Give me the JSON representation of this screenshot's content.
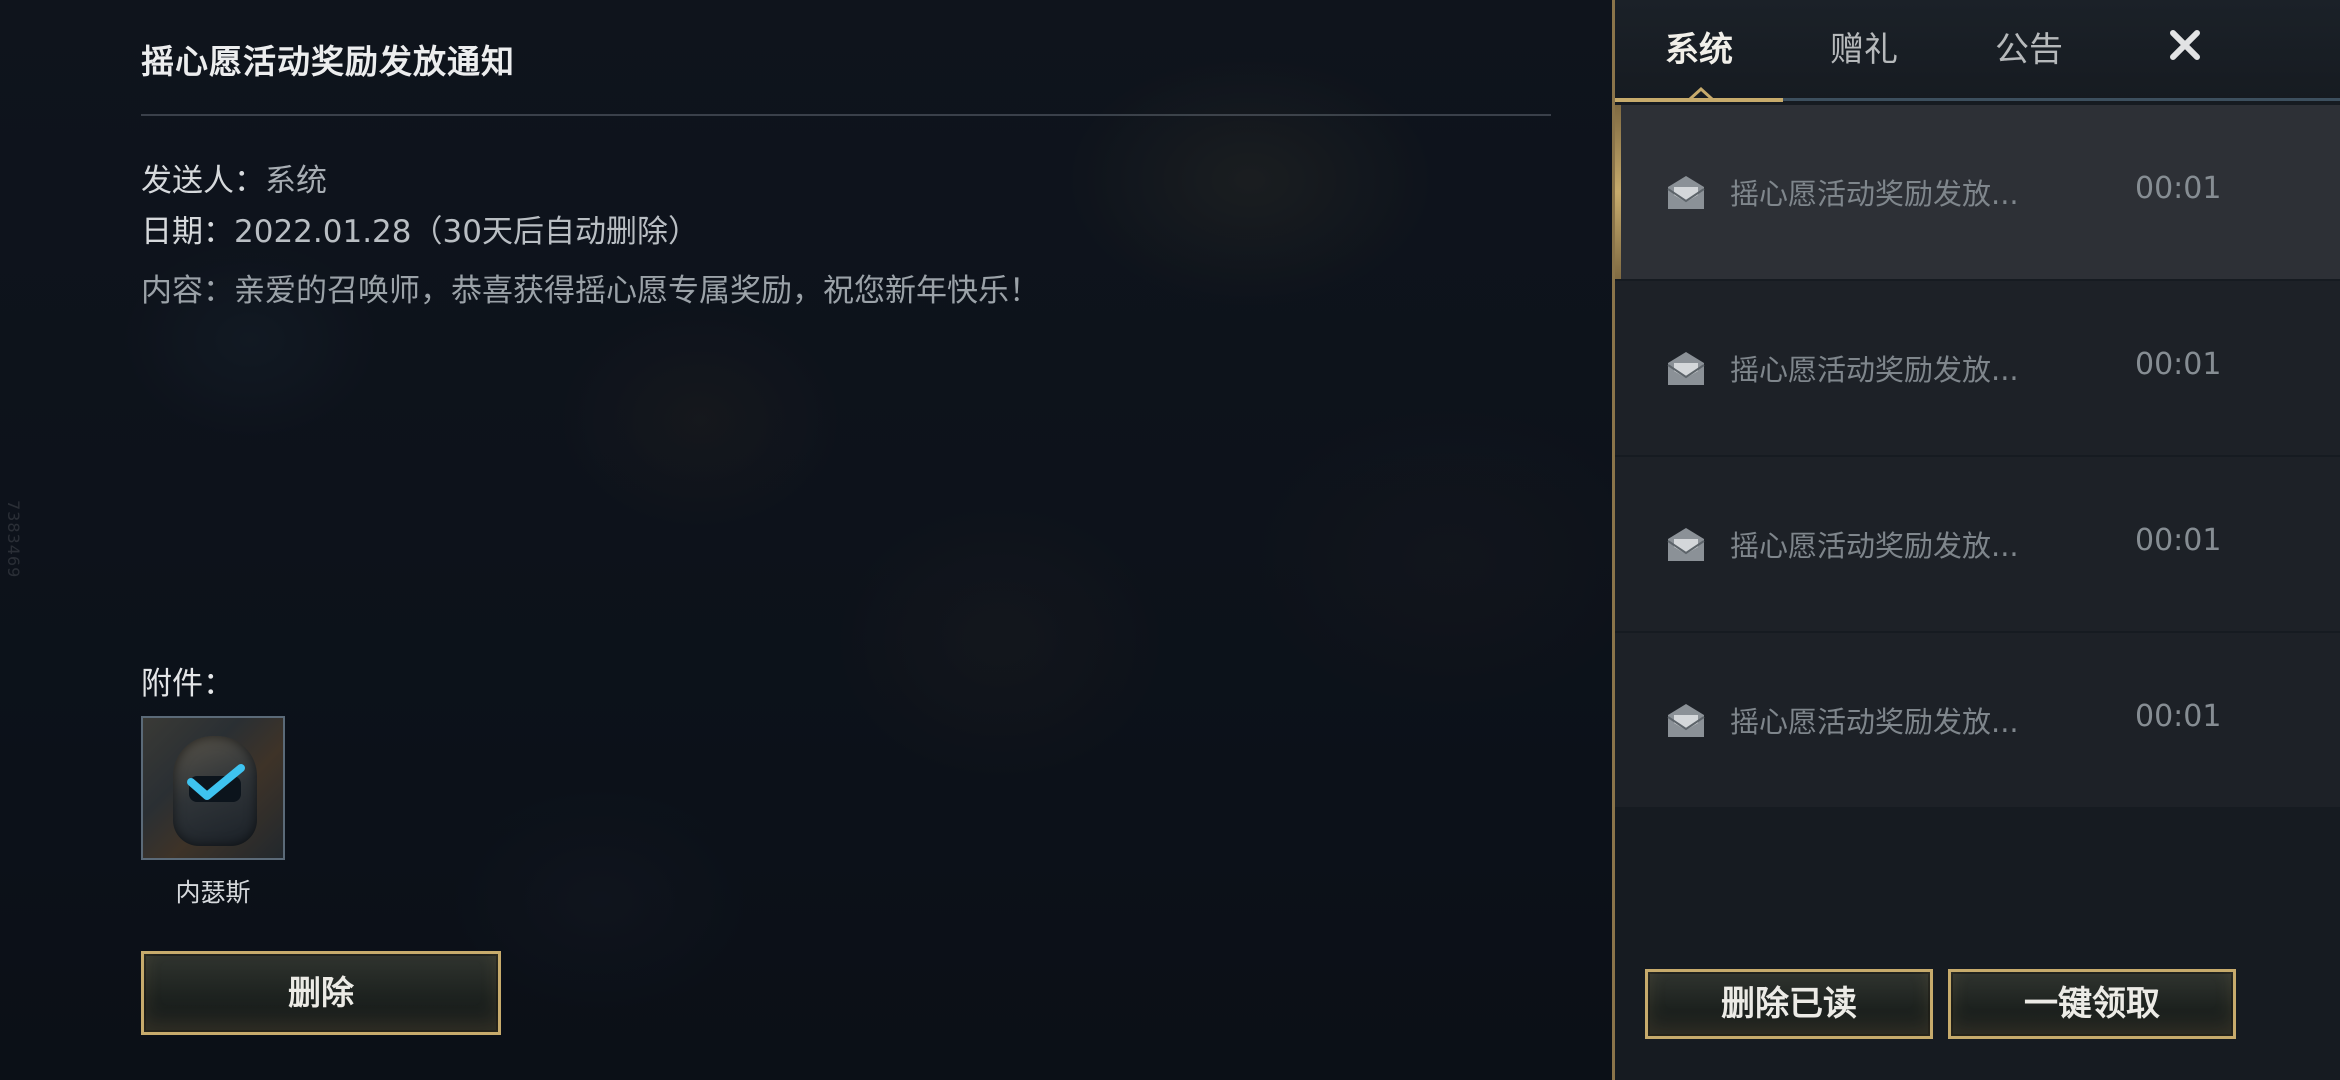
{
  "side_watermark": "7383469",
  "detail": {
    "title": "摇心愿活动奖励发放通知",
    "sender_label": "发送人：",
    "sender_value": "系统",
    "date_label": "日期：",
    "date_value": "2022.01.28（30天后自动删除）",
    "content_label": "内容：",
    "content_value": "亲爱的召唤师，恭喜获得摇心愿专属奖励，祝您新年快乐！",
    "attachment_label": "附件：",
    "attachments": [
      {
        "name": "内瑟斯",
        "icon": "champion-skin-icon",
        "claimed": true
      }
    ],
    "delete_button": "删除"
  },
  "panel": {
    "tabs": [
      {
        "label": "系统",
        "active": true
      },
      {
        "label": "赠礼",
        "active": false
      },
      {
        "label": "公告",
        "active": false
      }
    ],
    "close_icon": "close-icon",
    "mails": [
      {
        "icon": "opened-mail-icon",
        "subject": "摇心愿活动奖励发放...",
        "time": "00:01",
        "selected": true
      },
      {
        "icon": "opened-mail-icon",
        "subject": "摇心愿活动奖励发放...",
        "time": "00:01",
        "selected": false
      },
      {
        "icon": "opened-mail-icon",
        "subject": "摇心愿活动奖励发放...",
        "time": "00:01",
        "selected": false
      },
      {
        "icon": "opened-mail-icon",
        "subject": "摇心愿活动奖励发放...",
        "time": "00:01",
        "selected": false
      }
    ],
    "delete_read_button": "删除已读",
    "claim_all_button": "一键领取"
  },
  "colors": {
    "accent_gold": "#c7ab6c",
    "panel_bg": "#161b21",
    "selected_row": "#2d3036",
    "check_blue": "#3ec3f0"
  }
}
